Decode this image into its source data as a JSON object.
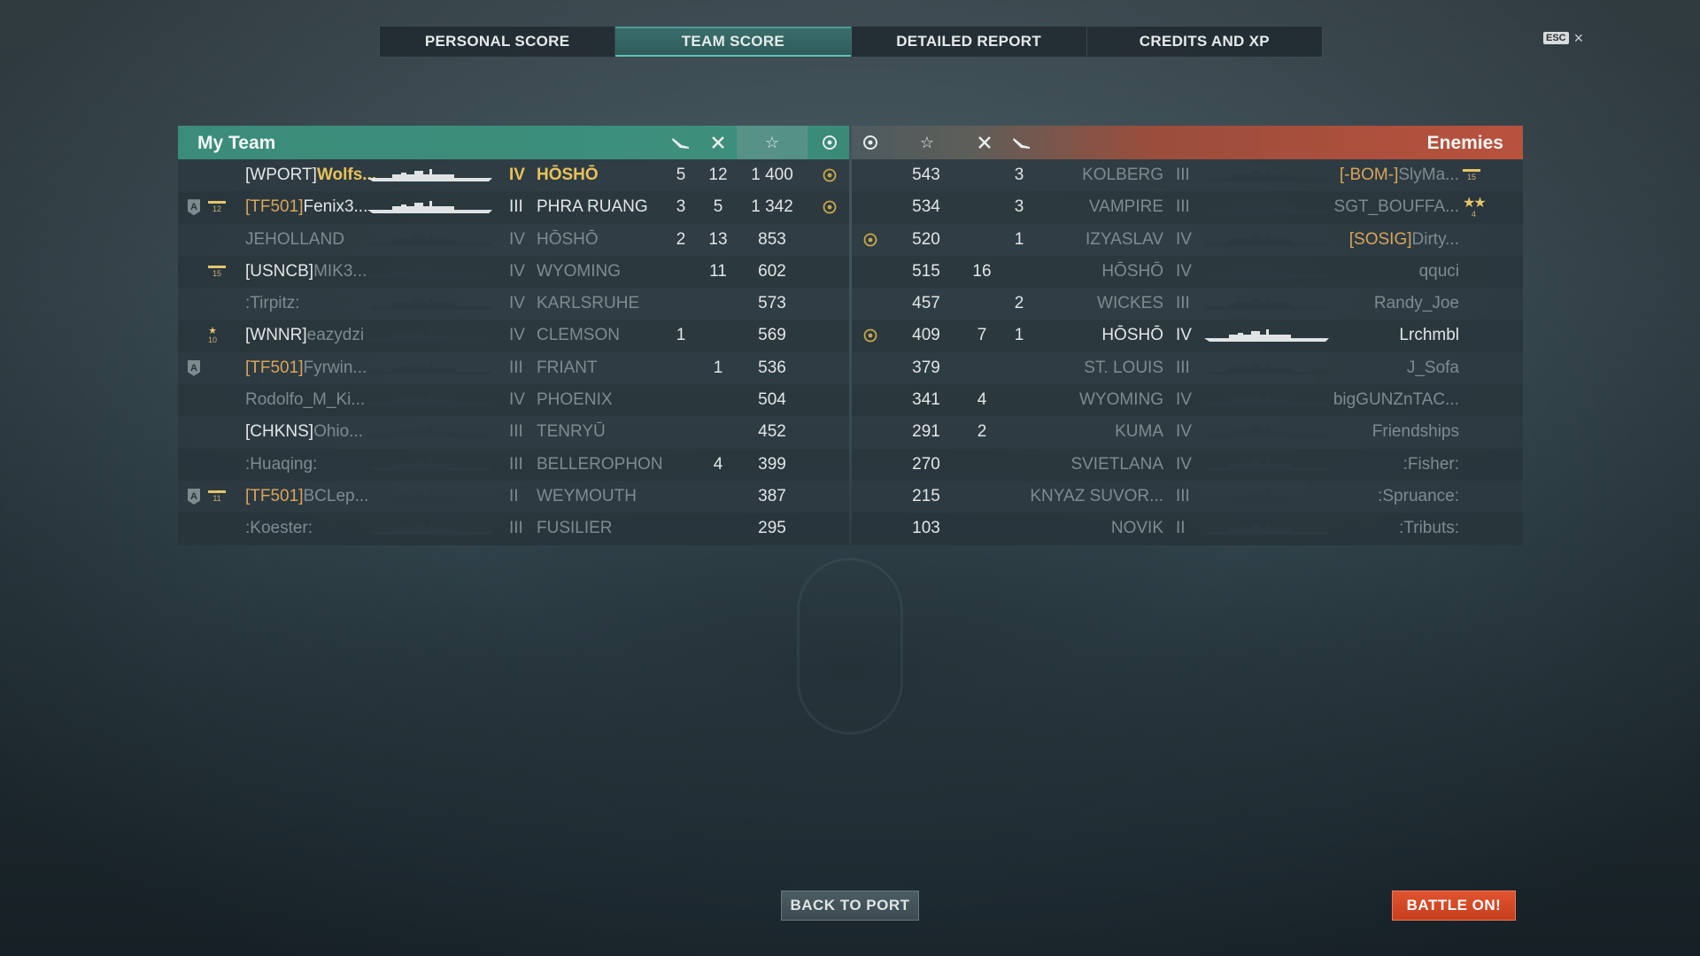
{
  "tabs": [
    {
      "label": "PERSONAL SCORE",
      "active": false
    },
    {
      "label": "TEAM SCORE",
      "active": true
    },
    {
      "label": "DETAILED REPORT",
      "active": false
    },
    {
      "label": "CREDITS AND XP",
      "active": false
    }
  ],
  "esc": {
    "key": "ESC",
    "close": "×"
  },
  "my_team": {
    "title": "My Team",
    "header_icons": [
      "plane-kills-icon",
      "frags-icon",
      "score-star-icon",
      "wreath-icon"
    ],
    "rows": [
      {
        "clan": "[WPORT]",
        "name": "Wolfs...",
        "tier": "IV",
        "ship": "HŌSHŌ",
        "planes": "5",
        "frags": "12",
        "score": "1 400",
        "wreath": true,
        "self": true,
        "clan_color": "bright",
        "name_color": "gold",
        "badge": "",
        "rank": ""
      },
      {
        "clan": "[TF501]",
        "name": "Fenix3...",
        "tier": "III",
        "ship": "PHRA RUANG",
        "planes": "3",
        "frags": "5",
        "score": "1 342",
        "wreath": true,
        "clan_color": "orange",
        "name_color": "bright",
        "badge": "A",
        "rank": "12"
      },
      {
        "clan": "",
        "name": "JEHOLLAND",
        "tier": "IV",
        "ship": "HŌSHŌ",
        "planes": "2",
        "frags": "13",
        "score": "853",
        "wreath": false,
        "clan_color": "dim",
        "name_color": "dim",
        "badge": "",
        "rank": ""
      },
      {
        "clan": "[USNCB]",
        "name": "MIK3...",
        "tier": "IV",
        "ship": "WYOMING",
        "planes": "",
        "frags": "11",
        "score": "602",
        "wreath": false,
        "clan_color": "bright",
        "name_color": "dim",
        "badge": "",
        "rank": "15"
      },
      {
        "clan": "",
        "name": ":Tirpitz:",
        "tier": "IV",
        "ship": "KARLSRUHE",
        "planes": "",
        "frags": "",
        "score": "573",
        "wreath": false,
        "clan_color": "dim",
        "name_color": "dim",
        "badge": "",
        "rank": ""
      },
      {
        "clan": "[WNNR]",
        "name": "eazydzi",
        "tier": "IV",
        "ship": "CLEMSON",
        "planes": "1",
        "frags": "",
        "score": "569",
        "wreath": false,
        "clan_color": "bright",
        "name_color": "dim",
        "badge": "",
        "rank": "10"
      },
      {
        "clan": "[TF501]",
        "name": "Fyrwin...",
        "tier": "III",
        "ship": "FRIANT",
        "planes": "",
        "frags": "1",
        "score": "536",
        "wreath": false,
        "clan_color": "orange",
        "name_color": "dim",
        "badge": "A",
        "rank": ""
      },
      {
        "clan": "",
        "name": "Rodolfo_M_Ki...",
        "tier": "IV",
        "ship": "PHOENIX",
        "planes": "",
        "frags": "",
        "score": "504",
        "wreath": false,
        "clan_color": "dim",
        "name_color": "dim",
        "badge": "",
        "rank": ""
      },
      {
        "clan": "[CHKNS]",
        "name": "Ohio...",
        "tier": "III",
        "ship": "TENRYŪ",
        "planes": "",
        "frags": "",
        "score": "452",
        "wreath": false,
        "clan_color": "bright",
        "name_color": "dim",
        "badge": "",
        "rank": ""
      },
      {
        "clan": "",
        "name": ":Huaqing:",
        "tier": "III",
        "ship": "BELLEROPHON",
        "planes": "",
        "frags": "4",
        "score": "399",
        "wreath": false,
        "clan_color": "dim",
        "name_color": "dim",
        "badge": "",
        "rank": ""
      },
      {
        "clan": "[TF501]",
        "name": "BCLep...",
        "tier": "II",
        "ship": "WEYMOUTH",
        "planes": "",
        "frags": "",
        "score": "387",
        "wreath": false,
        "clan_color": "orange",
        "name_color": "dim",
        "badge": "A",
        "rank": "11"
      },
      {
        "clan": "",
        "name": ":Koester:",
        "tier": "III",
        "ship": "FUSILIER",
        "planes": "",
        "frags": "",
        "score": "295",
        "wreath": false,
        "clan_color": "dim",
        "name_color": "dim",
        "badge": "",
        "rank": ""
      }
    ]
  },
  "enemies": {
    "title": "Enemies",
    "header_icons": [
      "wreath-icon",
      "score-star-icon",
      "frags-icon",
      "plane-kills-icon"
    ],
    "rows": [
      {
        "wreath": false,
        "score": "543",
        "frags": "",
        "planes": "3",
        "ship": "KOLBERG",
        "tier": "III",
        "clan": "[-BOM-]",
        "name": "SlyMa...",
        "rank": "15",
        "name_color": "dim",
        "ship_color": "dim"
      },
      {
        "wreath": false,
        "score": "534",
        "frags": "",
        "planes": "3",
        "ship": "VAMPIRE",
        "tier": "III",
        "clan": "",
        "name": "SGT_BOUFFA...",
        "rank": "4",
        "name_color": "dim",
        "ship_color": "dim"
      },
      {
        "wreath": true,
        "score": "520",
        "frags": "",
        "planes": "1",
        "ship": "IZYASLAV",
        "tier": "IV",
        "clan": "[SOSIG]",
        "name": "Dirty...",
        "rank": "",
        "name_color": "dim",
        "ship_color": "dim"
      },
      {
        "wreath": false,
        "score": "515",
        "frags": "16",
        "planes": "",
        "ship": "HŌSHŌ",
        "tier": "IV",
        "clan": "",
        "name": "qquci",
        "rank": "",
        "name_color": "dim",
        "ship_color": "dim"
      },
      {
        "wreath": false,
        "score": "457",
        "frags": "",
        "planes": "2",
        "ship": "WICKES",
        "tier": "III",
        "clan": "",
        "name": "Randy_Joe",
        "rank": "",
        "name_color": "dim",
        "ship_color": "dim"
      },
      {
        "wreath": true,
        "score": "409",
        "frags": "7",
        "planes": "1",
        "ship": "HŌSHŌ",
        "tier": "IV",
        "clan": "",
        "name": "Lrchmbl",
        "rank": "",
        "name_color": "bright",
        "ship_color": "bright"
      },
      {
        "wreath": false,
        "score": "379",
        "frags": "",
        "planes": "",
        "ship": "ST. LOUIS",
        "tier": "III",
        "clan": "",
        "name": "J_Sofa",
        "rank": "",
        "name_color": "dim",
        "ship_color": "dim"
      },
      {
        "wreath": false,
        "score": "341",
        "frags": "4",
        "planes": "",
        "ship": "WYOMING",
        "tier": "IV",
        "clan": "",
        "name": "bigGUNZnTAC...",
        "rank": "",
        "name_color": "dim",
        "ship_color": "dim"
      },
      {
        "wreath": false,
        "score": "291",
        "frags": "2",
        "planes": "",
        "ship": "KUMA",
        "tier": "IV",
        "clan": "",
        "name": "Friendships",
        "rank": "",
        "name_color": "dim",
        "ship_color": "dim"
      },
      {
        "wreath": false,
        "score": "270",
        "frags": "",
        "planes": "",
        "ship": "SVIETLANA",
        "tier": "IV",
        "clan": "",
        "name": ":Fisher:",
        "rank": "",
        "name_color": "dim",
        "ship_color": "dim"
      },
      {
        "wreath": false,
        "score": "215",
        "frags": "",
        "planes": "",
        "ship": "KNYAZ SUVOR...",
        "tier": "III",
        "clan": "",
        "name": ":Spruance:",
        "rank": "",
        "name_color": "dim",
        "ship_color": "dim"
      },
      {
        "wreath": false,
        "score": "103",
        "frags": "",
        "planes": "",
        "ship": "NOVIK",
        "tier": "II",
        "clan": "",
        "name": ":Tributs:",
        "rank": "",
        "name_color": "dim",
        "ship_color": "dim"
      }
    ]
  },
  "buttons": {
    "back": "BACK TO PORT",
    "battle": "BATTLE ON!"
  },
  "colors": {
    "accent_team": "#3b8c7a",
    "accent_enemy": "#b8523d",
    "highlight_gold": "#e9c25a",
    "battle_button": "#d24826"
  }
}
